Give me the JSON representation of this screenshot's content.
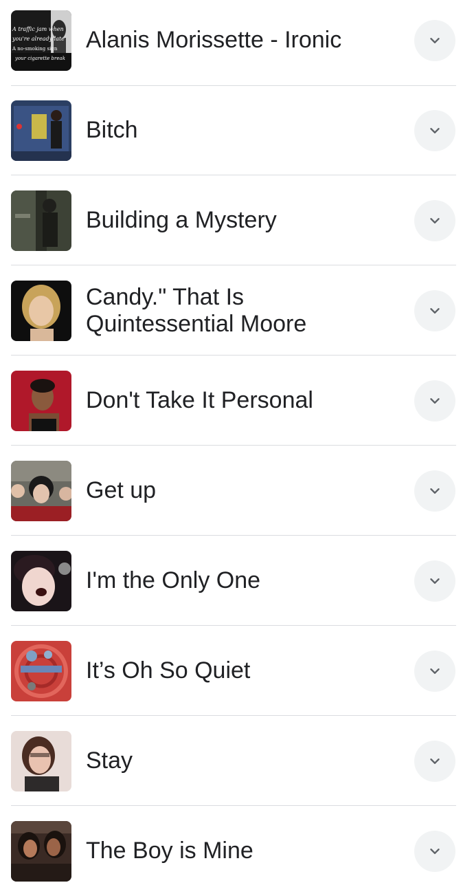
{
  "songs": [
    {
      "title": "Alanis Morissette - Ironic",
      "thumbnail": "alanis-ironic-thumbnail",
      "thumb_text": [
        "A traffic jam when",
        "you're already late",
        "A no-smoking sign",
        "your cigarette break"
      ]
    },
    {
      "title": "Bitch",
      "thumbnail": "bitch-thumbnail"
    },
    {
      "title": "Building a Mystery",
      "thumbnail": "building-a-mystery-thumbnail"
    },
    {
      "title": "Candy.\" That Is Quintessential Moore",
      "thumbnail": "candy-thumbnail"
    },
    {
      "title": "Don't Take It Personal",
      "thumbnail": "dont-take-it-personal-thumbnail"
    },
    {
      "title": "Get up",
      "thumbnail": "get-up-thumbnail"
    },
    {
      "title": "I'm the Only One",
      "thumbnail": "im-the-only-one-thumbnail"
    },
    {
      "title": "It’s Oh So Quiet",
      "thumbnail": "its-oh-so-quiet-thumbnail"
    },
    {
      "title": "Stay",
      "thumbnail": "stay-thumbnail"
    },
    {
      "title": "The Boy is Mine",
      "thumbnail": "the-boy-is-mine-thumbnail"
    }
  ],
  "icons": {
    "expand": "chevron-down-icon"
  },
  "colors": {
    "text": "#202124",
    "divider": "#dadce0",
    "button_bg": "#f1f3f4",
    "icon": "#5f6368"
  }
}
